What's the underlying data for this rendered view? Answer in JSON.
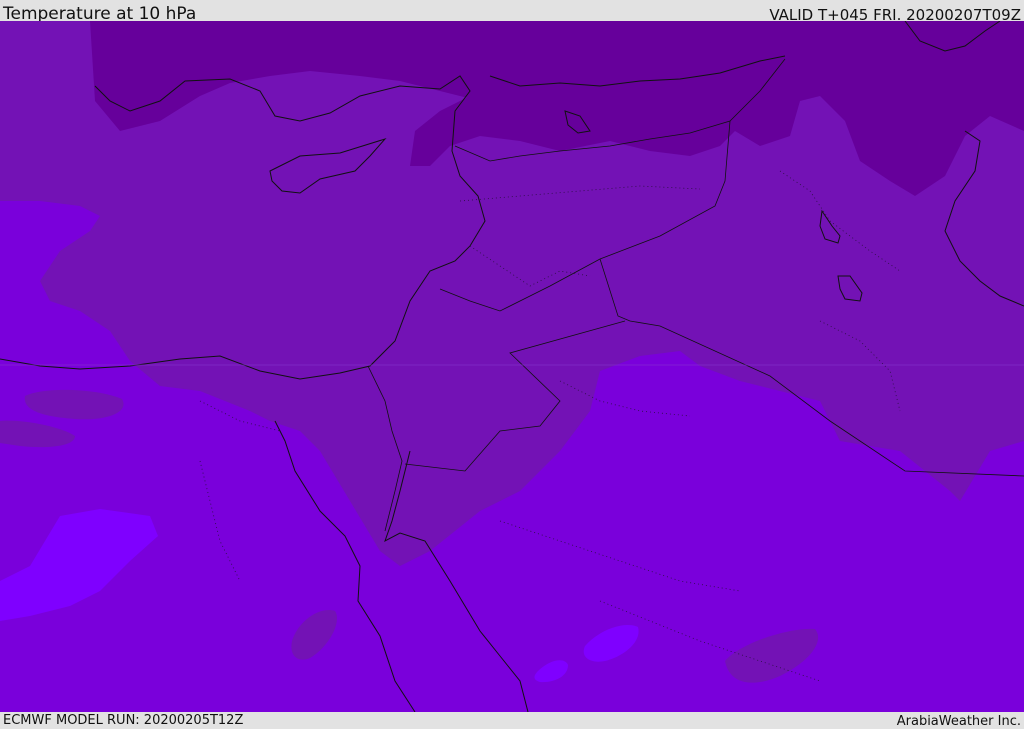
{
  "header": {
    "title": "Temperature at 10 hPa",
    "valid": "VALID T+045 FRI. 20200207T09Z"
  },
  "footer": {
    "model_run": "ECMWF MODEL RUN: 20200205T12Z",
    "credit": "ArabiaWeather Inc."
  },
  "map": {
    "field": "temperature",
    "level": "10 hPa",
    "colors": {
      "coldest": "#66009b",
      "cold": "#7312b5",
      "base": "#7a00db",
      "warm": "#7f00ff",
      "coast": "#111111"
    }
  }
}
